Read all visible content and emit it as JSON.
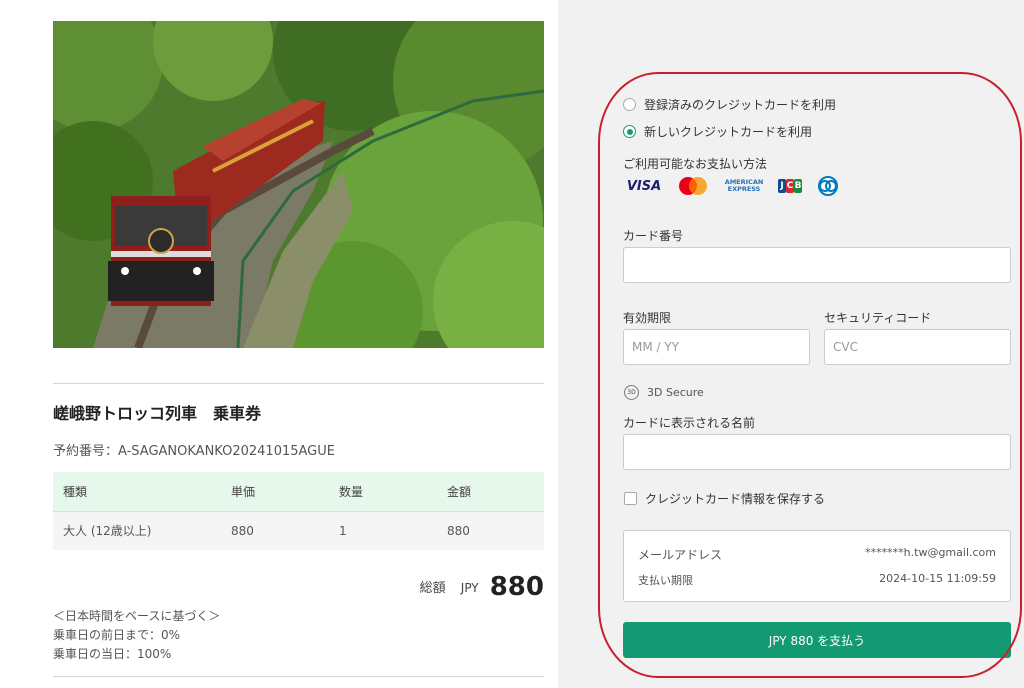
{
  "left": {
    "photo_alt": "",
    "ticket_title": "嵯峨野トロッコ列車　乗車券",
    "reservation": "予約番号：A-SAGANOKANKO20241015AGUE",
    "table": {
      "headers": [
        "種類",
        "単価",
        "数量",
        "金額"
      ],
      "rows": [
        [
          "大人 (12歳以上)",
          "880",
          "1",
          "880"
        ]
      ]
    },
    "total_label": "総額",
    "currency": "JPY",
    "total_amount": "880",
    "notes": [
      "＜日本時間をベースに基づく＞",
      "乗車日の前日まで：0%",
      "乗車日の当日：100%"
    ]
  },
  "payment": {
    "option_saved": "登録済みのクレジットカードを利用",
    "option_new": "新しいクレジットカードを利用",
    "selected_option": "new",
    "methods_label": "ご利用可能なお支払い方法",
    "card_brands": [
      "visa-icon",
      "mastercard-icon",
      "amex-icon",
      "jcb-icon",
      "diners-icon"
    ],
    "visa_text": "VISA",
    "amex_text_1": "AMERICAN",
    "amex_text_2": "EXPRESS",
    "jcb_letters": [
      "J",
      "C",
      "B"
    ],
    "card_number_label": "カード番号",
    "card_number_value": "",
    "expiry_label": "有効期限",
    "expiry_placeholder": "MM / YY",
    "cvc_label": "セキュリティコード",
    "cvc_placeholder": "CVC",
    "secure_badge": "3D",
    "secure_text": "3D Secure",
    "name_label": "カードに表示される名前",
    "name_value": "",
    "save_label": "クレジットカード情報を保存する",
    "save_checked": false,
    "email_key": "メールアドレス",
    "email_value": "*******h.tw@gmail.com",
    "deadline_key": "支払い期限",
    "deadline_value": "2024-10-15 11:09:59",
    "pay_button": "JPY 880 を支払う"
  },
  "colors": {
    "accent": "#139a73",
    "header_bg": "#e6f7ec",
    "highlight": "#c8202b",
    "panel_bg": "#f1f1f1"
  }
}
